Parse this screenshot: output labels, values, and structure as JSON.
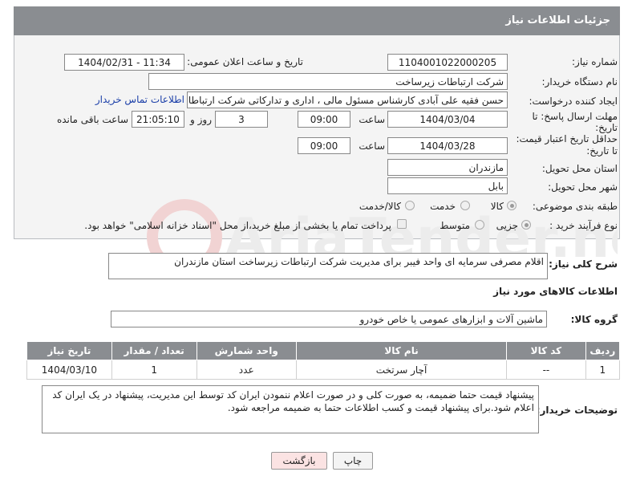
{
  "header": {
    "title": "جزئیات اطلاعات نیاز"
  },
  "form": {
    "need_number": {
      "label": "شماره نیاز:",
      "value": "1104001022000205"
    },
    "announce": {
      "label": "تاریخ و ساعت اعلان عمومی:",
      "value": "1404/02/31 - 11:34"
    },
    "buyer": {
      "label": "نام دستگاه خریدار:",
      "value": "شرکت ارتباطات زیرساخت"
    },
    "creator": {
      "label": "ایجاد کننده درخواست:",
      "value": "حسن فقیه علی آبادی کارشناس مسئول مالی ، اداری و تدارکاتی شرکت ارتباطات زیرساخت",
      "contact_link": "اطلاعات تماس خریدار"
    },
    "reply_deadline": {
      "label_line1": "مهلت ارسال پاسخ: تا",
      "label_line2": "تاریخ:",
      "date": "1404/03/04",
      "time_label": "ساعت",
      "time": "09:00",
      "days": "3",
      "days_label": "روز و",
      "remaining": "21:05:10",
      "remaining_label": "ساعت باقی مانده"
    },
    "price_validity": {
      "label_line1": "حداقل تاریخ اعتبار قیمت:",
      "label_line2": "تا تاریخ:",
      "date": "1404/03/28",
      "time_label": "ساعت",
      "time": "09:00"
    },
    "province": {
      "label": "استان محل تحویل:",
      "value": "مازندران"
    },
    "city": {
      "label": "شهر محل تحویل:",
      "value": "بابل"
    },
    "category": {
      "label": "طبقه بندی موضوعی:",
      "options": [
        "کالا",
        "خدمت",
        "کالا/خدمت"
      ],
      "selected": "کالا"
    },
    "process": {
      "label": "نوع فرآیند خرید :",
      "options": [
        "جزیی",
        "متوسط"
      ],
      "selected": "جزیی",
      "payment_note": "پرداخت تمام یا بخشی از مبلغ خرید،از محل \"اسناد خزانه اسلامی\" خواهد بود."
    }
  },
  "description": {
    "label": "شرح کلی نیاز:",
    "value": "اقلام مصرفی سرمایه ای واحد فیبر برای مدیریت شرکت ارتباطات  زیرساخت استان مازندران"
  },
  "goods_info": {
    "title": "اطلاعات کالاهای مورد نیاز"
  },
  "goods_group": {
    "label": "گروه کالا:",
    "value": "ماشین آلات و ابزارهای عمومی یا خاص خودرو"
  },
  "table": {
    "headers": [
      "ردیف",
      "کد کالا",
      "نام کالا",
      "واحد شمارش",
      "تعداد / مقدار",
      "تاریخ نیاز"
    ],
    "rows": [
      [
        "1",
        "--",
        "آچار سرتخت",
        "عدد",
        "1",
        "1404/03/10"
      ]
    ]
  },
  "buyer_notes": {
    "label": "توضیحات خریدار:",
    "value": "پیشنهاد قیمت حتما ضمیمه، به صورت کلی و در صورت اعلام ننمودن ایران کد توسط این مدیریت، پیشنهاد در یک ایران کد اعلام شود.برای پیشنهاد قیمت و کسب اطلاعات حتما به ضمیمه مراجعه شود."
  },
  "buttons": {
    "print": "چاپ",
    "back": "بازگشت"
  },
  "watermark": {
    "text": "AriaTender.neT"
  },
  "colors": {
    "header_bg": "#8a8d91",
    "link": "#1a3ea8",
    "back_button_bg": "#fbe3e3"
  }
}
